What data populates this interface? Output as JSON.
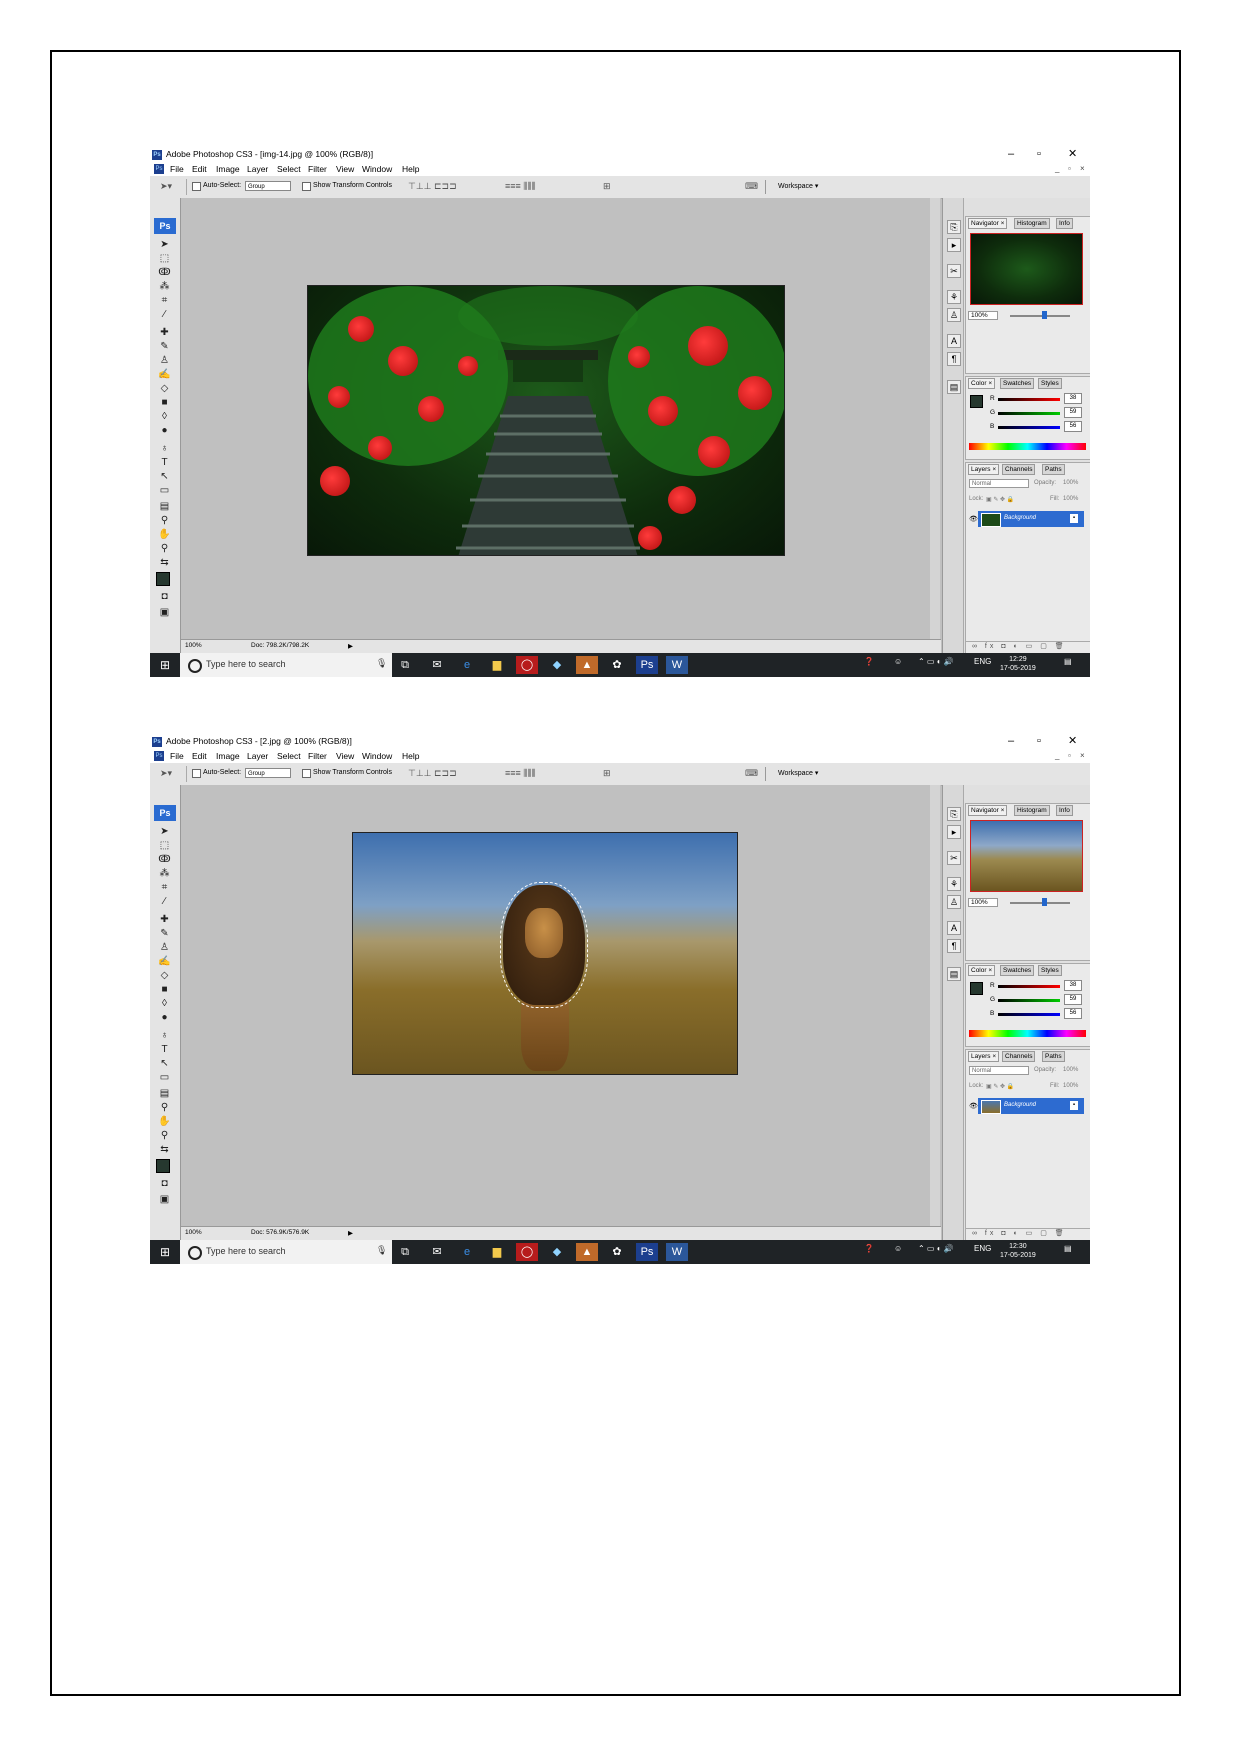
{
  "screenshots": [
    {
      "window_title": "Adobe Photoshop CS3 - [img-14.jpg @ 100% (RGB/8)]",
      "menu": [
        "File",
        "Edit",
        "Image",
        "Layer",
        "Select",
        "Filter",
        "View",
        "Window",
        "Help"
      ],
      "options": {
        "auto_select": "Auto-Select:",
        "group": "Group",
        "show_transform": "Show Transform Controls",
        "workspace": "Workspace ▾"
      },
      "status": {
        "zoom": "100%",
        "doc": "Doc: 798.2K/798.2K"
      },
      "panels": {
        "nav_tabs": [
          "Navigator ×",
          "Histogram",
          "Info"
        ],
        "nav_zoom": "100%",
        "color_tabs": [
          "Color ×",
          "Swatches",
          "Styles"
        ],
        "rgb": {
          "r": "38",
          "g": "59",
          "b": "56"
        },
        "layer_tabs": [
          "Layers ×",
          "Channels",
          "Paths"
        ],
        "blend_mode": "Normal",
        "opacity_label": "Opacity:",
        "opacity": "100%",
        "lock_label": "Lock:",
        "fill_label": "Fill:",
        "fill": "100%",
        "layer_name": "Background"
      },
      "taskbar": {
        "search": "Type here to search",
        "lang": "ENG",
        "time": "12:29",
        "date": "17-05-2019"
      }
    },
    {
      "window_title": "Adobe Photoshop CS3 - [2.jpg @ 100% (RGB/8)]",
      "menu": [
        "File",
        "Edit",
        "Image",
        "Layer",
        "Select",
        "Filter",
        "View",
        "Window",
        "Help"
      ],
      "options": {
        "auto_select": "Auto-Select:",
        "group": "Group",
        "show_transform": "Show Transform Controls",
        "workspace": "Workspace ▾"
      },
      "status": {
        "zoom": "100%",
        "doc": "Doc: 576.9K/576.9K"
      },
      "panels": {
        "nav_tabs": [
          "Navigator ×",
          "Histogram",
          "Info"
        ],
        "nav_zoom": "100%",
        "color_tabs": [
          "Color ×",
          "Swatches",
          "Styles"
        ],
        "rgb": {
          "r": "38",
          "g": "59",
          "b": "56"
        },
        "layer_tabs": [
          "Layers ×",
          "Channels",
          "Paths"
        ],
        "blend_mode": "Normal",
        "opacity_label": "Opacity:",
        "opacity": "100%",
        "lock_label": "Lock:",
        "fill_label": "Fill:",
        "fill": "100%",
        "layer_name": "Background"
      },
      "taskbar": {
        "search": "Type here to search",
        "lang": "ENG",
        "time": "12:30",
        "date": "17-05-2019"
      }
    }
  ],
  "colors": {
    "foreground_swatch": "#26382f",
    "layer_selected": "#2d6bd0",
    "taskbar": "#1f2326"
  }
}
